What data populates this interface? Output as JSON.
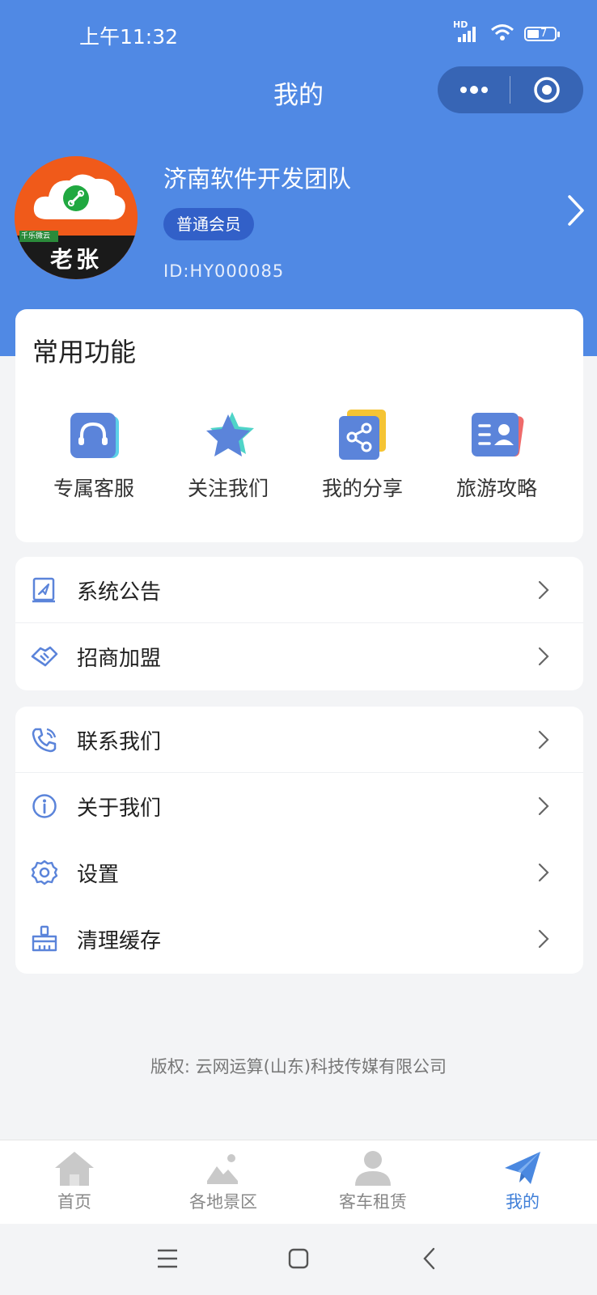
{
  "status_bar": {
    "time": "上午11:32",
    "signal_label": "HD",
    "battery_level": "7"
  },
  "nav": {
    "title": "我的"
  },
  "profile": {
    "name": "济南软件开发团队",
    "member_level": "普通会员",
    "id": "ID:HY000085",
    "avatar_text": "老张",
    "avatar_tag": "千乐微云"
  },
  "features": {
    "title": "常用功能",
    "items": [
      {
        "label": "专属客服",
        "icon": "headset-icon"
      },
      {
        "label": "关注我们",
        "icon": "star-icon"
      },
      {
        "label": "我的分享",
        "icon": "share-icon"
      },
      {
        "label": "旅游攻略",
        "icon": "guide-card-icon"
      }
    ]
  },
  "menu_group_1": [
    {
      "label": "系统公告",
      "icon": "announcement-icon"
    },
    {
      "label": "招商加盟",
      "icon": "handshake-icon"
    }
  ],
  "menu_group_2": [
    {
      "label": "联系我们",
      "icon": "phone-icon"
    },
    {
      "label": "关于我们",
      "icon": "info-icon"
    },
    {
      "label": "设置",
      "icon": "gear-icon"
    },
    {
      "label": "清理缓存",
      "icon": "broom-icon"
    }
  ],
  "footer": {
    "copyright": "版权: 云网运算(山东)科技传媒有限公司"
  },
  "tabbar": [
    {
      "label": "首页",
      "icon": "home-icon",
      "active": false
    },
    {
      "label": "各地景区",
      "icon": "scenery-icon",
      "active": false
    },
    {
      "label": "客车租赁",
      "icon": "person-icon",
      "active": false
    },
    {
      "label": "我的",
      "icon": "paper-plane-icon",
      "active": true
    }
  ],
  "colors": {
    "header": "#5089e4",
    "badge": "#3260c8",
    "capsule": "#3765b5",
    "accent": "#3f7fd8",
    "icon_blue": "#5b84da"
  }
}
